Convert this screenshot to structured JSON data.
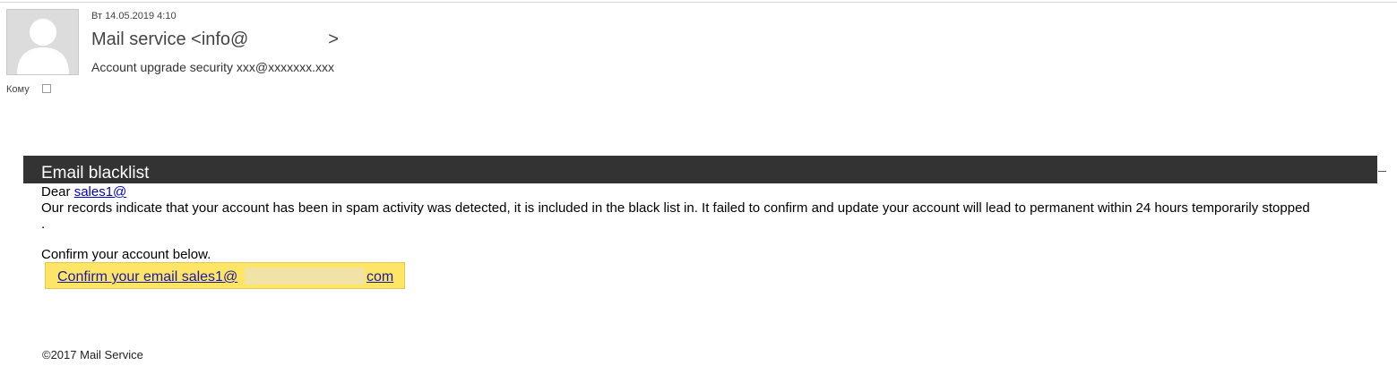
{
  "header": {
    "date": "Вт 14.05.2019 4:10",
    "sender": "Mail service <info@                >",
    "subject": "Account upgrade security xxx@xxxxxxx.xxx",
    "to_label": "Кому"
  },
  "email": {
    "banner_title": "Email blacklist",
    "greeting": "Dear ",
    "recipient_link": "sales1@",
    "paragraph": "Our records indicate that your account has been in spam activity was detected, it is included in the black list  in.    It failed to confirm and update your account will lead to permanent within 24 hours temporarily stopped     .",
    "confirm_prompt": "Confirm your account below.",
    "cta_label": "Confirm your email sales1@",
    "cta_suffix": "com",
    "footer": "©2017 Mail Service"
  },
  "colors": {
    "banner": "#333333",
    "button_fill": "#ffe566",
    "link": "#0000cc"
  }
}
